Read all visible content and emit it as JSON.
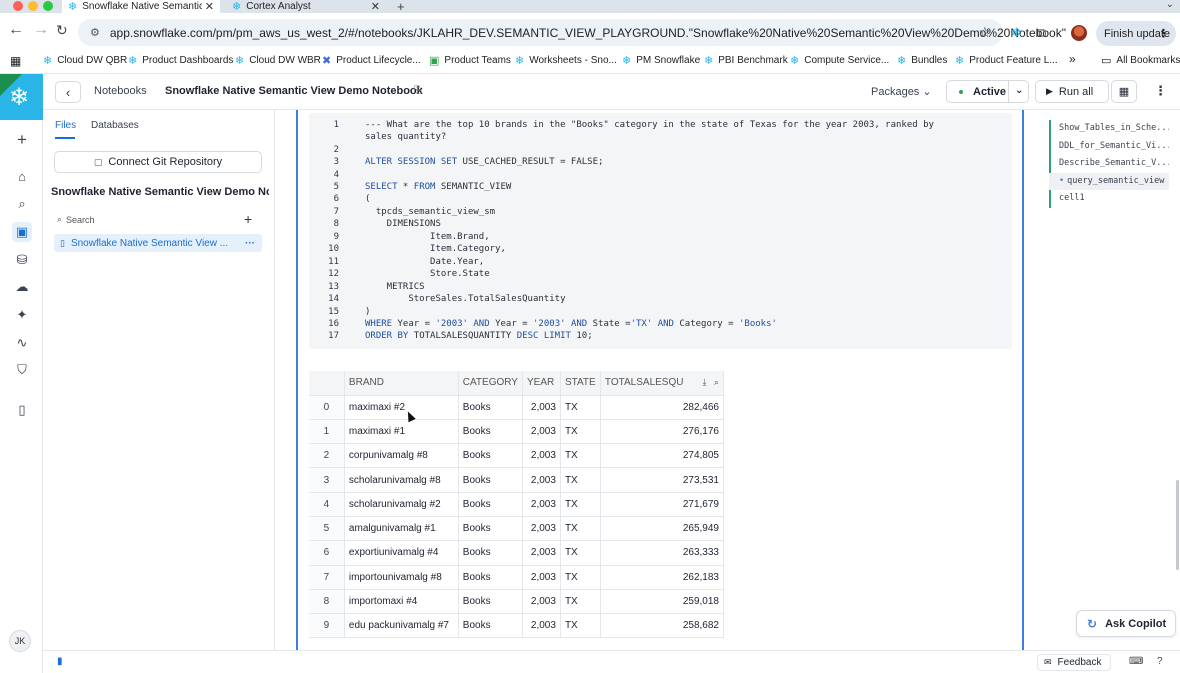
{
  "browser": {
    "tabs": [
      {
        "title": "Snowflake Native Semantic Vi",
        "close": "✕"
      },
      {
        "title": "Cortex Analyst",
        "close": "✕"
      }
    ],
    "new_tab": "+",
    "url": "app.snowflake.com/pm/pm_aws_us_west_2/#/notebooks/JKLAHR_DEV.SEMANTIC_VIEW_PLAYGROUND.\"Snowflake%20Native%20Semantic%20View%20Demo%20Notebook\"",
    "finish_update": "Finish update",
    "bookmarks": [
      {
        "label": "Cloud DW QBR",
        "icon": "❄"
      },
      {
        "label": "Product Dashboards",
        "icon": "❄"
      },
      {
        "label": "Cloud DW WBR",
        "icon": "❄"
      },
      {
        "label": "Product Lifecycle...",
        "icon": "✖"
      },
      {
        "label": "Product Teams",
        "icon": "▣"
      },
      {
        "label": "Worksheets - Sno...",
        "icon": "❄"
      },
      {
        "label": "PM Snowflake",
        "icon": "❄"
      },
      {
        "label": "PBI Benchmark",
        "icon": "❄"
      },
      {
        "label": "Compute Service...",
        "icon": "❄"
      },
      {
        "label": "Bundles",
        "icon": "❄"
      },
      {
        "label": "Product Feature L...",
        "icon": "❄"
      }
    ],
    "more_bookmarks": "»",
    "all_bookmarks": "All Bookmarks"
  },
  "topbar": {
    "back": "‹",
    "breadcrumb": "Notebooks",
    "title": "Snowflake Native Semantic View Demo Notebook",
    "packages": "Packages",
    "active": "Active",
    "run_all": "Run all"
  },
  "sidepanel": {
    "tabs": [
      "Files",
      "Databases"
    ],
    "git_button": "Connect Git Repository",
    "notebook_name": "Snowflake Native Semantic View Demo Not...",
    "search_placeholder": "Search",
    "file_item": "Snowflake Native Semantic View ..."
  },
  "code": [
    {
      "n": "1",
      "text": "--- What are the top 10 brands in the \"Books\" category in the state of Texas for the year 2003, ranked by"
    },
    {
      "n": "",
      "text": "sales quantity?"
    },
    {
      "n": "2",
      "text": ""
    },
    {
      "n": "3",
      "text": "ALTER SESSION SET USE_CACHED_RESULT = FALSE;"
    },
    {
      "n": "4",
      "text": ""
    },
    {
      "n": "5",
      "text": "SELECT * FROM SEMANTIC_VIEW"
    },
    {
      "n": "6",
      "text": "("
    },
    {
      "n": "7",
      "text": "  tpcds_semantic_view_sm"
    },
    {
      "n": "8",
      "text": "    DIMENSIONS"
    },
    {
      "n": "9",
      "text": "            Item.Brand,"
    },
    {
      "n": "10",
      "text": "            Item.Category,"
    },
    {
      "n": "11",
      "text": "            Date.Year,"
    },
    {
      "n": "12",
      "text": "            Store.State"
    },
    {
      "n": "13",
      "text": "    METRICS"
    },
    {
      "n": "14",
      "text": "        StoreSales.TotalSalesQuantity"
    },
    {
      "n": "15",
      "text": ")"
    },
    {
      "n": "16",
      "text": "WHERE Year = '2003' AND Year = '2003' AND State ='TX' AND Category = 'Books'"
    },
    {
      "n": "17",
      "text": "ORDER BY TOTALSALESQUANTITY DESC LIMIT 10;"
    }
  ],
  "table": {
    "columns": [
      "",
      "BRAND",
      "CATEGORY",
      "YEAR",
      "STATE",
      "TOTALSALESQU"
    ],
    "rows": [
      [
        "0",
        "maximaxi #2",
        "Books",
        "2,003",
        "TX",
        "282,466"
      ],
      [
        "1",
        "maximaxi #1",
        "Books",
        "2,003",
        "TX",
        "276,176"
      ],
      [
        "2",
        "corpunivamalg #8",
        "Books",
        "2,003",
        "TX",
        "274,805"
      ],
      [
        "3",
        "scholarunivamalg #8",
        "Books",
        "2,003",
        "TX",
        "273,531"
      ],
      [
        "4",
        "scholarunivamalg #2",
        "Books",
        "2,003",
        "TX",
        "271,679"
      ],
      [
        "5",
        "amalgunivamalg #1",
        "Books",
        "2,003",
        "TX",
        "265,949"
      ],
      [
        "6",
        "exportiunivamalg #4",
        "Books",
        "2,003",
        "TX",
        "263,333"
      ],
      [
        "7",
        "importounivamalg #8",
        "Books",
        "2,003",
        "TX",
        "262,183"
      ],
      [
        "8",
        "importomaxi #4",
        "Books",
        "2,003",
        "TX",
        "259,018"
      ],
      [
        "9",
        "edu packunivamalg #7",
        "Books",
        "2,003",
        "TX",
        "258,682"
      ]
    ]
  },
  "outline": [
    {
      "label": "Show_Tables_in_Sche...",
      "active": false
    },
    {
      "label": "DDL_for_Semantic_Vi...",
      "active": false
    },
    {
      "label": "Describe_Semantic_V...",
      "active": false
    },
    {
      "label": "query_semantic_view",
      "active": true
    },
    {
      "label": "cell1",
      "active": false
    }
  ],
  "ask_copilot": "Ask Copilot",
  "feedback": "Feedback",
  "avatar": "JK",
  "colors": {
    "accent": "#1a6fd1",
    "cell_border": "#3d7ee0",
    "snowflake": "#29b5e8",
    "keyword": "#1d4fa0"
  }
}
